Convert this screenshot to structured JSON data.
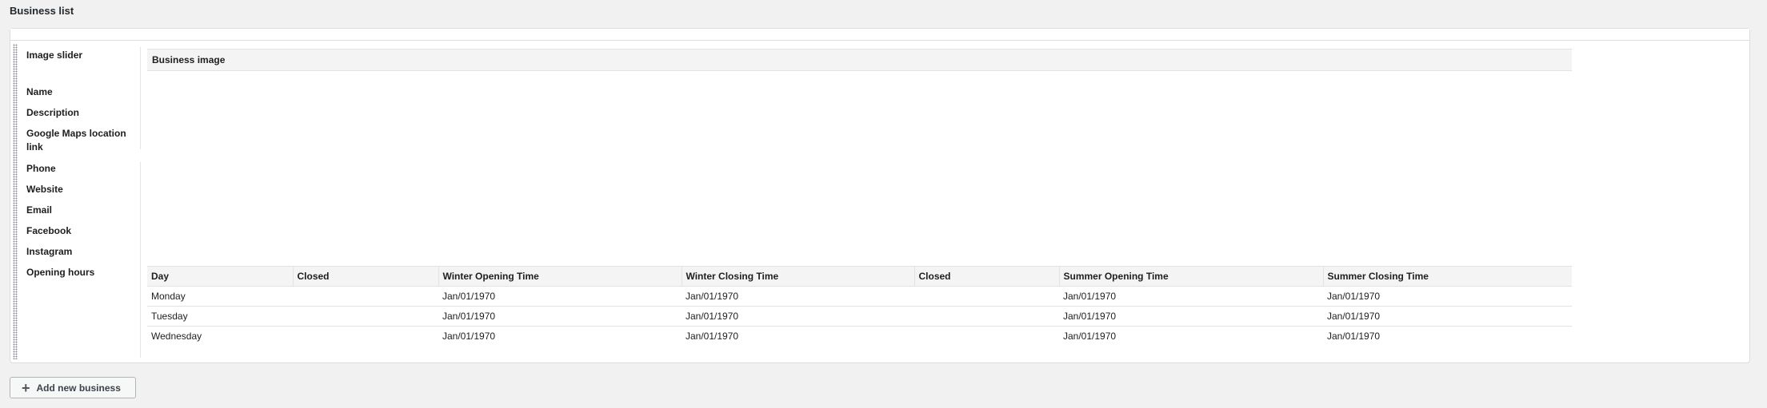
{
  "section": {
    "title": "Business list"
  },
  "labels": {
    "image_slider": "Image slider",
    "name": "Name",
    "description": "Description",
    "google_maps": "Google Maps location link",
    "phone": "Phone",
    "website": "Website",
    "email": "Email",
    "facebook": "Facebook",
    "instagram": "Instagram",
    "opening_hours": "Opening hours"
  },
  "image_table": {
    "header": "Business image"
  },
  "hours_table": {
    "columns": [
      "Day",
      "Closed",
      "Winter Opening Time",
      "Winter Closing Time",
      "Closed",
      "Summer Opening Time",
      "Summer Closing Time"
    ],
    "rows": [
      [
        "Monday",
        "",
        "Jan/01/1970",
        "Jan/01/1970",
        "",
        "Jan/01/1970",
        "Jan/01/1970"
      ],
      [
        "Tuesday",
        "",
        "Jan/01/1970",
        "Jan/01/1970",
        "",
        "Jan/01/1970",
        "Jan/01/1970"
      ],
      [
        "Wednesday",
        "",
        "Jan/01/1970",
        "Jan/01/1970",
        "",
        "Jan/01/1970",
        "Jan/01/1970"
      ]
    ]
  },
  "actions": {
    "add_label": "Add new business",
    "add_icon": "plus-icon"
  }
}
